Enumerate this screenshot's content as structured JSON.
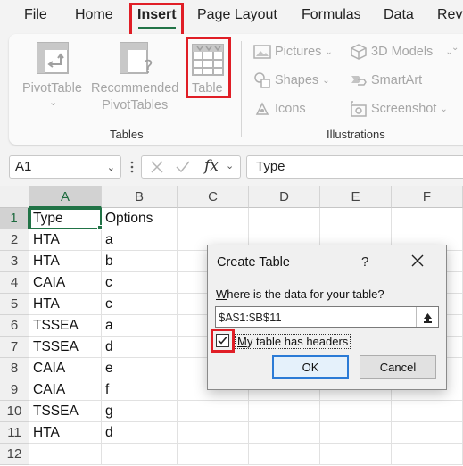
{
  "ribbon_tabs": [
    "File",
    "Home",
    "Insert",
    "Page Layout",
    "Formulas",
    "Data",
    "Rev"
  ],
  "active_tab": "Insert",
  "accent_color": "#217346",
  "highlight_color": "#e01e26",
  "tables_group": {
    "label": "Tables",
    "pivottable": "PivotTable",
    "recommended_line1": "Recommended",
    "recommended_line2": "PivotTables",
    "table": "Table"
  },
  "illustrations_group": {
    "label": "Illustrations",
    "pictures": "Pictures",
    "shapes": "Shapes",
    "icons": "Icons",
    "models_3d": "3D Models",
    "smartart": "SmartArt",
    "screenshot": "Screenshot"
  },
  "formula_bar": {
    "name_box": "A1",
    "fx": "fx",
    "content": "Type"
  },
  "columns": [
    "A",
    "B",
    "C",
    "D",
    "E",
    "F"
  ],
  "rows": [
    "1",
    "2",
    "3",
    "4",
    "5",
    "6",
    "7",
    "8",
    "9",
    "10",
    "11",
    "12"
  ],
  "cells": [
    [
      "Type",
      "Options"
    ],
    [
      "HTA",
      "a"
    ],
    [
      "HTA",
      "b"
    ],
    [
      "CAIA",
      "c"
    ],
    [
      "HTA",
      "c"
    ],
    [
      "TSSEA",
      "a"
    ],
    [
      "TSSEA",
      "d"
    ],
    [
      "CAIA",
      "e"
    ],
    [
      "CAIA",
      "f"
    ],
    [
      "TSSEA",
      "g"
    ],
    [
      "HTA",
      "d"
    ],
    [
      "",
      ""
    ]
  ],
  "dialog": {
    "title": "Create Table",
    "help": "?",
    "prompt": "Where is the data for your table?",
    "range": "$A$1:$B$11",
    "has_headers_label": "My table has headers",
    "has_headers_checked": true,
    "ok": "OK",
    "cancel": "Cancel"
  }
}
